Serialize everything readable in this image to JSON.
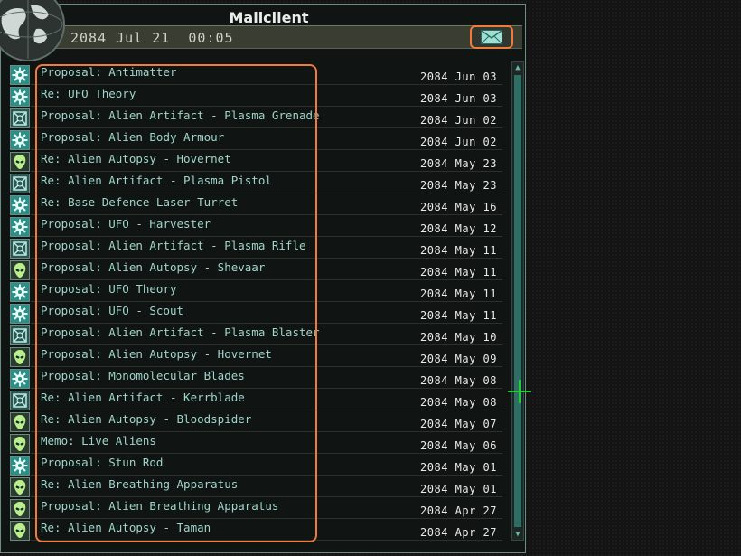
{
  "window": {
    "title": "Mailclient"
  },
  "header": {
    "datetime": "2084 Jul 21  00:05"
  },
  "mails": [
    {
      "icon": "gear",
      "subject": "Proposal: Antimatter",
      "date": "2084 Jun 03"
    },
    {
      "icon": "gear",
      "subject": "Re: UFO Theory",
      "date": "2084 Jun 03"
    },
    {
      "icon": "artifact",
      "subject": "Proposal: Alien Artifact - Plasma Grenade",
      "date": "2084 Jun 02"
    },
    {
      "icon": "gear",
      "subject": "Proposal: Alien Body Armour",
      "date": "2084 Jun 02"
    },
    {
      "icon": "alien",
      "subject": "Re: Alien Autopsy - Hovernet",
      "date": "2084 May 23"
    },
    {
      "icon": "artifact",
      "subject": "Re: Alien Artifact - Plasma Pistol",
      "date": "2084 May 23"
    },
    {
      "icon": "gear",
      "subject": "Re: Base-Defence Laser Turret",
      "date": "2084 May 16"
    },
    {
      "icon": "gear",
      "subject": "Proposal: UFO - Harvester",
      "date": "2084 May 12"
    },
    {
      "icon": "artifact",
      "subject": "Proposal: Alien Artifact - Plasma Rifle",
      "date": "2084 May 11"
    },
    {
      "icon": "alien",
      "subject": "Proposal: Alien Autopsy - Shevaar",
      "date": "2084 May 11"
    },
    {
      "icon": "gear",
      "subject": "Proposal: UFO Theory",
      "date": "2084 May 11"
    },
    {
      "icon": "gear",
      "subject": "Proposal: UFO - Scout",
      "date": "2084 May 11"
    },
    {
      "icon": "artifact",
      "subject": "Proposal: Alien Artifact - Plasma Blaster",
      "date": "2084 May 10"
    },
    {
      "icon": "alien",
      "subject": "Proposal: Alien Autopsy - Hovernet",
      "date": "2084 May 09"
    },
    {
      "icon": "gear",
      "subject": "Proposal: Monomolecular Blades",
      "date": "2084 May 08"
    },
    {
      "icon": "artifact",
      "subject": "Re: Alien Artifact - Kerrblade",
      "date": "2084 May 08"
    },
    {
      "icon": "alien",
      "subject": "Re: Alien Autopsy - Bloodspider",
      "date": "2084 May 07"
    },
    {
      "icon": "alien",
      "subject": "Memo: Live Aliens",
      "date": "2084 May 06"
    },
    {
      "icon": "gear",
      "subject": "Proposal: Stun Rod",
      "date": "2084 May 01"
    },
    {
      "icon": "alien",
      "subject": "Re: Alien Breathing Apparatus",
      "date": "2084 May 01"
    },
    {
      "icon": "alien",
      "subject": "Proposal: Alien Breathing Apparatus",
      "date": "2084 Apr 27"
    },
    {
      "icon": "alien",
      "subject": "Re: Alien Autopsy - Taman",
      "date": "2084 Apr 27"
    }
  ],
  "colors": {
    "accent_highlight": "#f07b3a",
    "subject_text": "#9fd5cb",
    "date_text": "#eaeaea",
    "panel_border": "#6f8c84",
    "cursor": "#22cc33"
  }
}
